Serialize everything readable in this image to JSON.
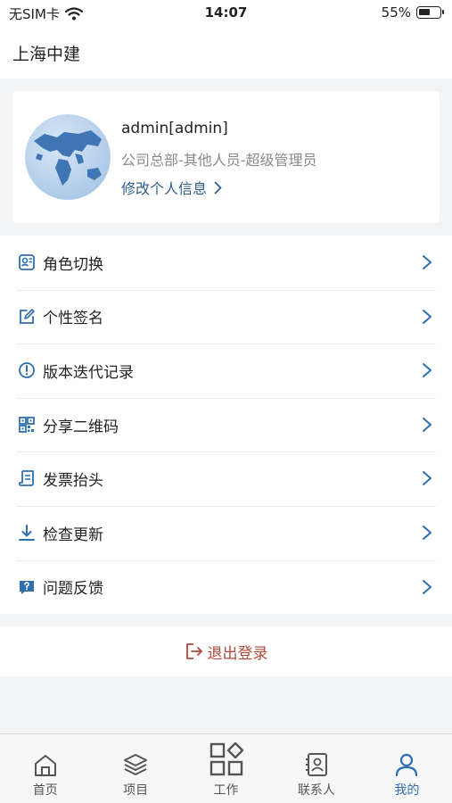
{
  "status_bar": {
    "carrier": "无SIM卡",
    "time": "14:07",
    "battery_percent": "55%",
    "battery_level": 0.55
  },
  "header": {
    "title": "上海中建"
  },
  "profile": {
    "name": "admin[admin]",
    "department": "公司总部-其他人员-超级管理员",
    "edit_label": "修改个人信息"
  },
  "menu": {
    "items": [
      {
        "label": "角色切换",
        "icon": "role-switch-icon"
      },
      {
        "label": "个性签名",
        "icon": "signature-icon"
      },
      {
        "label": "版本迭代记录",
        "icon": "info-icon"
      },
      {
        "label": "分享二维码",
        "icon": "qr-code-icon"
      },
      {
        "label": "发票抬头",
        "icon": "invoice-icon"
      },
      {
        "label": "检查更新",
        "icon": "download-icon"
      },
      {
        "label": "问题反馈",
        "icon": "feedback-icon"
      }
    ]
  },
  "logout": {
    "label": "退出登录"
  },
  "tabs": [
    {
      "label": "首页",
      "icon": "home-icon"
    },
    {
      "label": "项目",
      "icon": "layers-icon"
    },
    {
      "label": "工作",
      "icon": "grid-icon"
    },
    {
      "label": "联系人",
      "icon": "contacts-icon"
    },
    {
      "label": "我的",
      "icon": "person-icon",
      "active": true
    }
  ],
  "colors": {
    "accent": "#2f6fb0",
    "link": "#2f5e8e",
    "logout": "#b24a3a",
    "background": "#f2f3f5"
  }
}
